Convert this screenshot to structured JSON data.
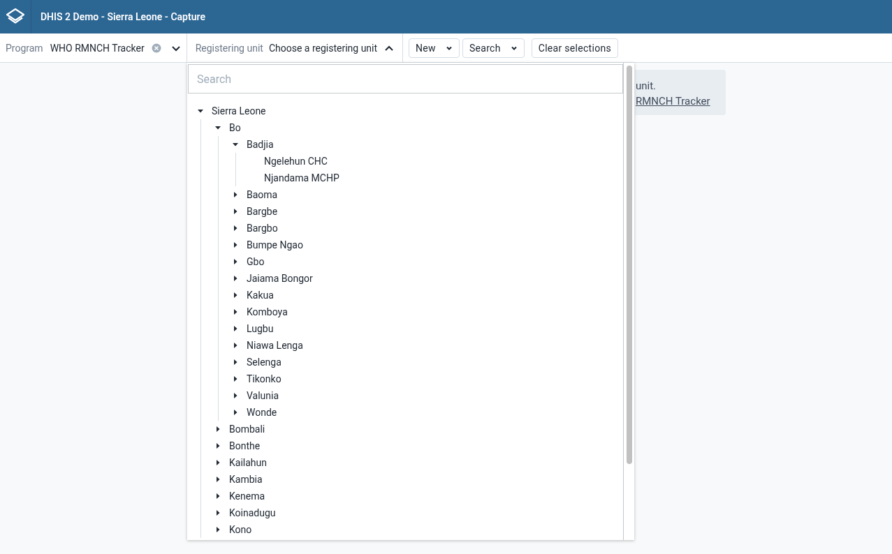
{
  "header": {
    "title": "DHIS 2 Demo - Sierra Leone - Capture"
  },
  "program": {
    "label": "Program",
    "value": "WHO RMNCH Tracker"
  },
  "registering_unit": {
    "label": "Registering unit",
    "value": "Choose a registering unit",
    "expanded": true
  },
  "buttons": [
    {
      "label": "New",
      "kind": "menu"
    },
    {
      "label": "Search",
      "kind": "menu"
    },
    {
      "label": "Clear selections",
      "kind": "plain"
    }
  ],
  "info": {
    "text": "unit.",
    "link": "RMNCH Tracker"
  },
  "org_unit_picker": {
    "search": {
      "placeholder": "Search"
    },
    "tree": [
      {
        "label": "Sierra Leone",
        "expanded": true,
        "children": [
          {
            "label": "Bo",
            "expanded": true,
            "children": [
              {
                "label": "Badjia",
                "expanded": true,
                "children": [
                  {
                    "label": "Ngelehun CHC"
                  },
                  {
                    "label": "Njandama MCHP"
                  }
                ]
              },
              {
                "label": "Baoma",
                "expanded": false
              },
              {
                "label": "Bargbe",
                "expanded": false
              },
              {
                "label": "Bargbo",
                "expanded": false
              },
              {
                "label": "Bumpe Ngao",
                "expanded": false
              },
              {
                "label": "Gbo",
                "expanded": false
              },
              {
                "label": "Jaiama Bongor",
                "expanded": false
              },
              {
                "label": "Kakua",
                "expanded": false
              },
              {
                "label": "Komboya",
                "expanded": false
              },
              {
                "label": "Lugbu",
                "expanded": false
              },
              {
                "label": "Niawa Lenga",
                "expanded": false
              },
              {
                "label": "Selenga",
                "expanded": false
              },
              {
                "label": "Tikonko",
                "expanded": false
              },
              {
                "label": "Valunia",
                "expanded": false
              },
              {
                "label": "Wonde",
                "expanded": false
              }
            ]
          },
          {
            "label": "Bombali",
            "expanded": false
          },
          {
            "label": "Bonthe",
            "expanded": false
          },
          {
            "label": "Kailahun",
            "expanded": false
          },
          {
            "label": "Kambia",
            "expanded": false
          },
          {
            "label": "Kenema",
            "expanded": false
          },
          {
            "label": "Koinadugu",
            "expanded": false
          },
          {
            "label": "Kono",
            "expanded": false
          }
        ]
      }
    ]
  }
}
